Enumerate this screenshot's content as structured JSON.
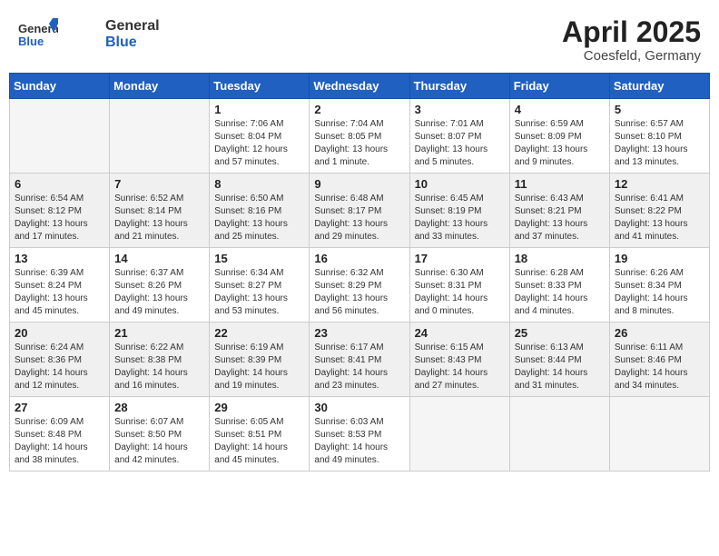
{
  "header": {
    "logo_general": "General",
    "logo_blue": "Blue",
    "month_title": "April 2025",
    "subtitle": "Coesfeld, Germany"
  },
  "weekdays": [
    "Sunday",
    "Monday",
    "Tuesday",
    "Wednesday",
    "Thursday",
    "Friday",
    "Saturday"
  ],
  "weeks": [
    [
      {
        "day": "",
        "sunrise": "",
        "sunset": "",
        "daylight": "",
        "empty": true
      },
      {
        "day": "",
        "sunrise": "",
        "sunset": "",
        "daylight": "",
        "empty": true
      },
      {
        "day": "1",
        "sunrise": "Sunrise: 7:06 AM",
        "sunset": "Sunset: 8:04 PM",
        "daylight": "Daylight: 12 hours and 57 minutes."
      },
      {
        "day": "2",
        "sunrise": "Sunrise: 7:04 AM",
        "sunset": "Sunset: 8:05 PM",
        "daylight": "Daylight: 13 hours and 1 minute."
      },
      {
        "day": "3",
        "sunrise": "Sunrise: 7:01 AM",
        "sunset": "Sunset: 8:07 PM",
        "daylight": "Daylight: 13 hours and 5 minutes."
      },
      {
        "day": "4",
        "sunrise": "Sunrise: 6:59 AM",
        "sunset": "Sunset: 8:09 PM",
        "daylight": "Daylight: 13 hours and 9 minutes."
      },
      {
        "day": "5",
        "sunrise": "Sunrise: 6:57 AM",
        "sunset": "Sunset: 8:10 PM",
        "daylight": "Daylight: 13 hours and 13 minutes."
      }
    ],
    [
      {
        "day": "6",
        "sunrise": "Sunrise: 6:54 AM",
        "sunset": "Sunset: 8:12 PM",
        "daylight": "Daylight: 13 hours and 17 minutes."
      },
      {
        "day": "7",
        "sunrise": "Sunrise: 6:52 AM",
        "sunset": "Sunset: 8:14 PM",
        "daylight": "Daylight: 13 hours and 21 minutes."
      },
      {
        "day": "8",
        "sunrise": "Sunrise: 6:50 AM",
        "sunset": "Sunset: 8:16 PM",
        "daylight": "Daylight: 13 hours and 25 minutes."
      },
      {
        "day": "9",
        "sunrise": "Sunrise: 6:48 AM",
        "sunset": "Sunset: 8:17 PM",
        "daylight": "Daylight: 13 hours and 29 minutes."
      },
      {
        "day": "10",
        "sunrise": "Sunrise: 6:45 AM",
        "sunset": "Sunset: 8:19 PM",
        "daylight": "Daylight: 13 hours and 33 minutes."
      },
      {
        "day": "11",
        "sunrise": "Sunrise: 6:43 AM",
        "sunset": "Sunset: 8:21 PM",
        "daylight": "Daylight: 13 hours and 37 minutes."
      },
      {
        "day": "12",
        "sunrise": "Sunrise: 6:41 AM",
        "sunset": "Sunset: 8:22 PM",
        "daylight": "Daylight: 13 hours and 41 minutes."
      }
    ],
    [
      {
        "day": "13",
        "sunrise": "Sunrise: 6:39 AM",
        "sunset": "Sunset: 8:24 PM",
        "daylight": "Daylight: 13 hours and 45 minutes."
      },
      {
        "day": "14",
        "sunrise": "Sunrise: 6:37 AM",
        "sunset": "Sunset: 8:26 PM",
        "daylight": "Daylight: 13 hours and 49 minutes."
      },
      {
        "day": "15",
        "sunrise": "Sunrise: 6:34 AM",
        "sunset": "Sunset: 8:27 PM",
        "daylight": "Daylight: 13 hours and 53 minutes."
      },
      {
        "day": "16",
        "sunrise": "Sunrise: 6:32 AM",
        "sunset": "Sunset: 8:29 PM",
        "daylight": "Daylight: 13 hours and 56 minutes."
      },
      {
        "day": "17",
        "sunrise": "Sunrise: 6:30 AM",
        "sunset": "Sunset: 8:31 PM",
        "daylight": "Daylight: 14 hours and 0 minutes."
      },
      {
        "day": "18",
        "sunrise": "Sunrise: 6:28 AM",
        "sunset": "Sunset: 8:33 PM",
        "daylight": "Daylight: 14 hours and 4 minutes."
      },
      {
        "day": "19",
        "sunrise": "Sunrise: 6:26 AM",
        "sunset": "Sunset: 8:34 PM",
        "daylight": "Daylight: 14 hours and 8 minutes."
      }
    ],
    [
      {
        "day": "20",
        "sunrise": "Sunrise: 6:24 AM",
        "sunset": "Sunset: 8:36 PM",
        "daylight": "Daylight: 14 hours and 12 minutes."
      },
      {
        "day": "21",
        "sunrise": "Sunrise: 6:22 AM",
        "sunset": "Sunset: 8:38 PM",
        "daylight": "Daylight: 14 hours and 16 minutes."
      },
      {
        "day": "22",
        "sunrise": "Sunrise: 6:19 AM",
        "sunset": "Sunset: 8:39 PM",
        "daylight": "Daylight: 14 hours and 19 minutes."
      },
      {
        "day": "23",
        "sunrise": "Sunrise: 6:17 AM",
        "sunset": "Sunset: 8:41 PM",
        "daylight": "Daylight: 14 hours and 23 minutes."
      },
      {
        "day": "24",
        "sunrise": "Sunrise: 6:15 AM",
        "sunset": "Sunset: 8:43 PM",
        "daylight": "Daylight: 14 hours and 27 minutes."
      },
      {
        "day": "25",
        "sunrise": "Sunrise: 6:13 AM",
        "sunset": "Sunset: 8:44 PM",
        "daylight": "Daylight: 14 hours and 31 minutes."
      },
      {
        "day": "26",
        "sunrise": "Sunrise: 6:11 AM",
        "sunset": "Sunset: 8:46 PM",
        "daylight": "Daylight: 14 hours and 34 minutes."
      }
    ],
    [
      {
        "day": "27",
        "sunrise": "Sunrise: 6:09 AM",
        "sunset": "Sunset: 8:48 PM",
        "daylight": "Daylight: 14 hours and 38 minutes."
      },
      {
        "day": "28",
        "sunrise": "Sunrise: 6:07 AM",
        "sunset": "Sunset: 8:50 PM",
        "daylight": "Daylight: 14 hours and 42 minutes."
      },
      {
        "day": "29",
        "sunrise": "Sunrise: 6:05 AM",
        "sunset": "Sunset: 8:51 PM",
        "daylight": "Daylight: 14 hours and 45 minutes."
      },
      {
        "day": "30",
        "sunrise": "Sunrise: 6:03 AM",
        "sunset": "Sunset: 8:53 PM",
        "daylight": "Daylight: 14 hours and 49 minutes."
      },
      {
        "day": "",
        "sunrise": "",
        "sunset": "",
        "daylight": "",
        "empty": true
      },
      {
        "day": "",
        "sunrise": "",
        "sunset": "",
        "daylight": "",
        "empty": true
      },
      {
        "day": "",
        "sunrise": "",
        "sunset": "",
        "daylight": "",
        "empty": true
      }
    ]
  ]
}
